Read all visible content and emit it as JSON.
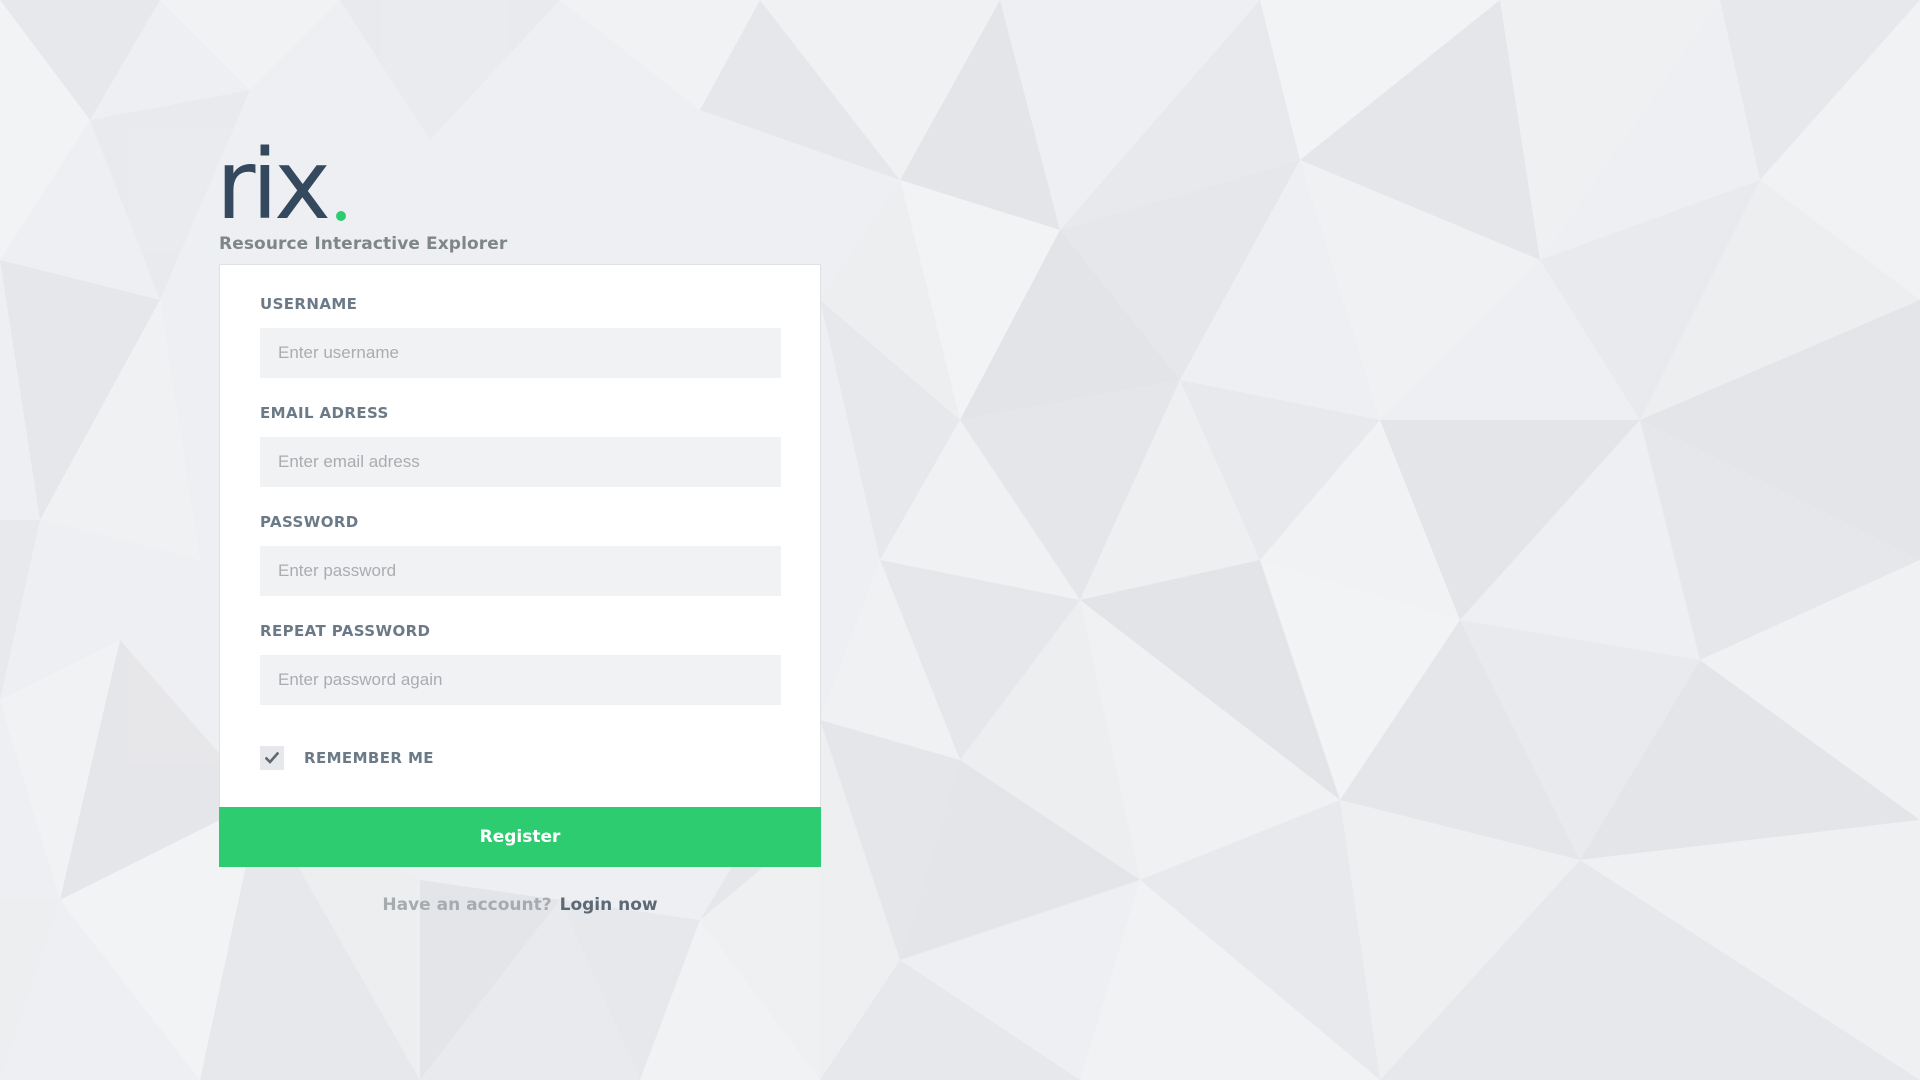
{
  "brand": {
    "logo_text": "rix",
    "tagline": "Resource Interactive Explorer",
    "logo_color": "#34495e",
    "accent_color": "#2ecc71"
  },
  "form": {
    "fields": [
      {
        "label": "USERNAME",
        "placeholder": "Enter username",
        "value": ""
      },
      {
        "label": "EMAIL ADRESS",
        "placeholder": "Enter email adress",
        "value": ""
      },
      {
        "label": "PASSWORD",
        "placeholder": "Enter password",
        "value": ""
      },
      {
        "label": "REPEAT PASSWORD",
        "placeholder": "Enter password again",
        "value": ""
      }
    ],
    "remember": {
      "label": "REMEMBER ME",
      "checked": true,
      "icon": "check-icon"
    },
    "submit_label": "Register"
  },
  "footer": {
    "question": "Have an account?",
    "link_label": "Login now"
  },
  "colors": {
    "background": "#eeeff2",
    "button": "#2ecc71",
    "label": "#6b7a86",
    "input_bg": "#f1f2f4"
  }
}
